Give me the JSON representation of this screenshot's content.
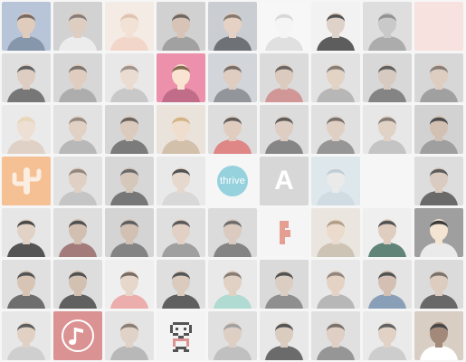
{
  "wall": {
    "tiles": [
      {
        "kind": "face",
        "bg": "#a9b9d0",
        "skin": "#d9c1ae",
        "shirt": "#6c7f99",
        "hair": "#5a4a3f"
      },
      {
        "kind": "face",
        "bg": "#c9c9c9",
        "skin": "#d7c3b4",
        "shirt": "#e8e8e8",
        "hair": "#6d6058"
      },
      {
        "kind": "face",
        "bg": "#f2e7de",
        "skin": "#f0dbcc",
        "shirt": "#efcdbd",
        "hair": "#d8b6a0"
      },
      {
        "kind": "face",
        "bg": "#c7c7c7",
        "skin": "#d0b8a6",
        "shirt": "#8d8d8d",
        "hair": "#4e4640"
      },
      {
        "kind": "face",
        "bg": "#bfc3c7",
        "skin": "#e0c9b8",
        "shirt": "#4f5358",
        "hair": "#6c5b4e"
      },
      {
        "kind": "face",
        "bg": "#f6f6f6",
        "skin": "#f3f3f3",
        "shirt": "#d9d9d9",
        "hair": "#cfcfcf"
      },
      {
        "kind": "face",
        "bg": "#efefef",
        "skin": "#d8c8bc",
        "shirt": "#3a3a3a",
        "hair": "#2f2f2f"
      },
      {
        "kind": "face",
        "bg": "#d7d7d7",
        "skin": "#bdbdbd",
        "shirt": "#9a9a9a",
        "hair": "#7a7a7a"
      },
      {
        "kind": "plain",
        "bg": "#f6dcd8"
      },
      {
        "kind": "face",
        "bg": "#d8d8d8",
        "skin": "#d6c3b6",
        "shirt": "#5a5a5a",
        "hair": "#3f3f3f"
      },
      {
        "kind": "face",
        "bg": "#cfcfcf",
        "skin": "#d9c3b2",
        "shirt": "#9c9c9c",
        "hair": "#5f5550"
      },
      {
        "kind": "face",
        "bg": "#e3e3e3",
        "skin": "#e7d5c8",
        "shirt": "#bcbcbc",
        "hair": "#8a7c72"
      },
      {
        "kind": "face",
        "bg": "#e8789a",
        "skin": "#f7dfc7",
        "shirt": "#b44d6f",
        "hair": "#6a4b2e"
      },
      {
        "kind": "face",
        "bg": "#c8cdd2",
        "skin": "#d7c2b2",
        "shirt": "#7b7f84",
        "hair": "#5b5048"
      },
      {
        "kind": "face",
        "bg": "#d4d4d4",
        "skin": "#d4c0b1",
        "shirt": "#c77f7f",
        "hair": "#4c4440"
      },
      {
        "kind": "face",
        "bg": "#dcdcdc",
        "skin": "#dccab9",
        "shirt": "#a8a8a8",
        "hair": "#6b6159"
      },
      {
        "kind": "face",
        "bg": "#d0d0d0",
        "skin": "#cfc0b4",
        "shirt": "#6a6a6a",
        "hair": "#3e3e3e"
      },
      {
        "kind": "face",
        "bg": "#cfcfcf",
        "skin": "#d7c4b5",
        "shirt": "#8b8b8b",
        "hair": "#6e6259"
      },
      {
        "kind": "face",
        "bg": "#e6e6e6",
        "skin": "#ead8ca",
        "shirt": "#d8c7b9",
        "hair": "#e0cfa8"
      },
      {
        "kind": "face",
        "bg": "#dcdcdc",
        "skin": "#dbc7b8",
        "shirt": "#a9a9a9",
        "hair": "#7e7065"
      },
      {
        "kind": "face",
        "bg": "#cdcdcd",
        "skin": "#d3bfb0",
        "shirt": "#5e5e5e",
        "hair": "#4a423c"
      },
      {
        "kind": "face",
        "bg": "#e6ddd3",
        "skin": "#ecd7c3",
        "shirt": "#c9b398",
        "hair": "#c9a36c"
      },
      {
        "kind": "face",
        "bg": "#d6d6d6",
        "skin": "#d9c3b2",
        "shirt": "#d86c6c",
        "hair": "#3f3a36"
      },
      {
        "kind": "face",
        "bg": "#d5d5d5",
        "skin": "#d6c3b5",
        "shirt": "#6c6c6c",
        "hair": "#3c3734"
      },
      {
        "kind": "face",
        "bg": "#d9d9d9",
        "skin": "#dac6b7",
        "shirt": "#7f7f7f",
        "hair": "#5c534c"
      },
      {
        "kind": "face",
        "bg": "#e2e2e2",
        "skin": "#dbc8ba",
        "shirt": "#b7b7b7",
        "hair": "#6b6058"
      },
      {
        "kind": "face",
        "bg": "#c9c9c9",
        "skin": "#c9b3a3",
        "shirt": "#8a8a8a",
        "hair": "#262626"
      },
      {
        "kind": "cactus",
        "bg": "#f2b27d",
        "fg": "#fbe9d9"
      },
      {
        "kind": "face",
        "bg": "#dcdcdc",
        "skin": "#d9c5b6",
        "shirt": "#b9b9b9",
        "hair": "#7a6d63"
      },
      {
        "kind": "face",
        "bg": "#cfcfcf",
        "skin": "#cdbbad",
        "shirt": "#5a5a5a",
        "hair": "#4b4b4b"
      },
      {
        "kind": "face",
        "bg": "#e5e5e5",
        "skin": "#e2d0c3",
        "shirt": "#d0d0d0",
        "hair": "#2e2e2e"
      },
      {
        "kind": "wordmark",
        "bg": "#f4f4f4",
        "text": "thrive"
      },
      {
        "kind": "monogram",
        "bg": "#cfcfcf",
        "text": "A"
      },
      {
        "kind": "face",
        "bg": "#d6e2e8",
        "skin": "#e6e6e6",
        "shirt": "#c7d5dc",
        "hair": "#b2c3cb"
      },
      {
        "kind": "plain",
        "bg": "#f4f4f4"
      },
      {
        "kind": "face",
        "bg": "#d6d6d6",
        "skin": "#d2c0b3",
        "shirt": "#4a4a4a",
        "hair": "#3a3a3a"
      },
      {
        "kind": "face",
        "bg": "#e1e1e1",
        "skin": "#dbc8b9",
        "shirt": "#2f2f2f",
        "hair": "#232323"
      },
      {
        "kind": "face",
        "bg": "#d7d7d7",
        "skin": "#c9b19e",
        "shirt": "#8f5f5f",
        "hair": "#2a2a2a"
      },
      {
        "kind": "face",
        "bg": "#cbcbcb",
        "skin": "#c8b3a2",
        "shirt": "#6a6a6a",
        "hair": "#3b3b3b"
      },
      {
        "kind": "face",
        "bg": "#d8d8d8",
        "skin": "#dbc6b6",
        "shirt": "#8a8a8a",
        "hair": "#353535"
      },
      {
        "kind": "face",
        "bg": "#d3d3d3",
        "skin": "#d2bfb1",
        "shirt": "#696969",
        "hair": "#4d4d4d"
      },
      {
        "kind": "lettermark",
        "bg": "#f3f3f3",
        "fg": "#e08a7a"
      },
      {
        "kind": "face",
        "bg": "#e6e1d8",
        "skin": "#e6d4c1",
        "shirt": "#c3b7a7",
        "hair": "#a28a70"
      },
      {
        "kind": "face",
        "bg": "#ececec",
        "skin": "#d8c3b3",
        "shirt": "#3f6a5c",
        "hair": "#2c2c2c"
      },
      {
        "kind": "face",
        "bg": "#8a8a8a",
        "skin": "#f2dfc8",
        "shirt": "#e6e6e6",
        "hair": "#111111"
      },
      {
        "kind": "face",
        "bg": "#d9d9d9",
        "skin": "#cfb7a5",
        "shirt": "#4f4f4f",
        "hair": "#2e2e2e"
      },
      {
        "kind": "face",
        "bg": "#d6d6d6",
        "skin": "#c9b2a0",
        "shirt": "#3d3d3d",
        "hair": "#2a2a2a"
      },
      {
        "kind": "face",
        "bg": "#ececec",
        "skin": "#e2cfc0",
        "shirt": "#e89b9b",
        "hair": "#5b4c42"
      },
      {
        "kind": "face",
        "bg": "#d8d8d8",
        "skin": "#d4c0b1",
        "shirt": "#3c3c3c",
        "hair": "#2f2f2f"
      },
      {
        "kind": "face",
        "bg": "#e4e4e4",
        "skin": "#dbc7b8",
        "shirt": "#9fd3c9",
        "hair": "#6e6157"
      },
      {
        "kind": "face",
        "bg": "#d2d2d2",
        "skin": "#d4c2b4",
        "shirt": "#777777",
        "hair": "#2c2c2c"
      },
      {
        "kind": "face",
        "bg": "#e3e3e3",
        "skin": "#dfcab9",
        "shirt": "#a8a8a8",
        "hair": "#7a6b60"
      },
      {
        "kind": "face",
        "bg": "#dedede",
        "skin": "#cbb3a1",
        "shirt": "#6f8aa8",
        "hair": "#2d2d2d"
      },
      {
        "kind": "face",
        "bg": "#d3d3d3",
        "skin": "#d5c2b3",
        "shirt": "#474747",
        "hair": "#5d524a"
      },
      {
        "kind": "face",
        "bg": "#e2e2e2",
        "skin": "#dbc7b8",
        "shirt": "#c5c5c5",
        "hair": "#3a3a3a"
      },
      {
        "kind": "music",
        "bg": "#d47b7b",
        "fg": "#ffffff"
      },
      {
        "kind": "face",
        "bg": "#dedede",
        "skin": "#dbc9bb",
        "shirt": "#a9a9a9",
        "hair": "#6f6259"
      },
      {
        "kind": "pixel",
        "bg": "#f1f1f1",
        "fg": "#2e2e2e",
        "accent": "#d57a7a"
      },
      {
        "kind": "face",
        "bg": "#dadada",
        "skin": "#d7c5b7",
        "shirt": "#b2b2b2",
        "hair": "#8d8d8d"
      },
      {
        "kind": "face",
        "bg": "#e3e3e3",
        "skin": "#d4c1b3",
        "shirt": "#4b4b4b",
        "hair": "#2f2f2f"
      },
      {
        "kind": "face",
        "bg": "#d9d9d9",
        "skin": "#d8c5b7",
        "shirt": "#7f7f7f",
        "hair": "#5c534c"
      },
      {
        "kind": "face",
        "bg": "#e6e6e6",
        "skin": "#dcc9ba",
        "shirt": "#c2c2c2",
        "hair": "#3f3f3f"
      },
      {
        "kind": "face",
        "bg": "#d0c4b8",
        "skin": "#8e6f5c",
        "shirt": "#ffffff",
        "hair": "#1e1e1e"
      }
    ]
  }
}
